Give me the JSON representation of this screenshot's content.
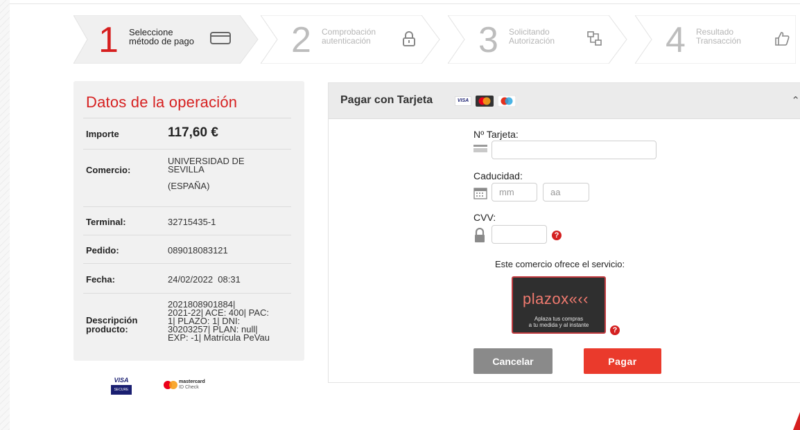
{
  "steps": [
    {
      "number": "1",
      "line1": "Seleccione",
      "line2": "método de pago",
      "icon": "credit-card-icon",
      "active": true
    },
    {
      "number": "2",
      "line1": "Comprobación",
      "line2": "autenticación",
      "icon": "lock-icon",
      "active": false
    },
    {
      "number": "3",
      "line1": "Solicitando",
      "line2": "Autorización",
      "icon": "network-icon",
      "active": false
    },
    {
      "number": "4",
      "line1": "Resultado",
      "line2": "Transacción",
      "icon": "thumbs-up-icon",
      "active": false
    }
  ],
  "operation": {
    "title": "Datos de la operación",
    "importe_label": "Importe",
    "importe_value": "117,60 €",
    "comercio_label": "Comercio:",
    "comercio_value_1": "UNIVERSIDAD DE",
    "comercio_value_2": "SEVILLA",
    "comercio_value_3": "(ESPAÑA)",
    "terminal_label": "Terminal:",
    "terminal_value": "32715435-1",
    "pedido_label": "Pedido:",
    "pedido_value": "089018083121",
    "fecha_label": "Fecha:",
    "fecha_value": "24/02/2022  08:31",
    "descripcion_label_1": "Descripción",
    "descripcion_label_2": "producto:",
    "descripcion_lines": [
      "2021808901884|",
      "2021-22| ACE: 400| PAC:",
      "1| PLAZO: 1| DNI:",
      "30203257| PLAN: null|",
      "EXP: -1| Matrícula PeVau"
    ]
  },
  "footer_badges": {
    "visa": "VISA",
    "visa_sub": "SECURE",
    "mastercard": "mastercard",
    "mastercard_sub": "ID Check"
  },
  "payment": {
    "header_title": "Pagar con Tarjeta",
    "visa_mini": "VISA",
    "card_label": "Nº Tarjeta:",
    "card_value": "",
    "expiry_label": "Caducidad:",
    "month_placeholder": "mm",
    "year_placeholder": "aa",
    "cvv_label": "CVV:",
    "cvv_value": "",
    "service_text": "Este comercio ofrece el servicio:",
    "plazox_logo": "plazox«‹‹",
    "plazox_tagline_1": "Aplaza tus compras",
    "plazox_tagline_2": "a tu medida y al instante",
    "help_mark": "?",
    "cancel_label": "Cancelar",
    "pay_label": "Pagar"
  },
  "colors": {
    "accent_red": "#d61f1f",
    "pay_button": "#ea3a2c",
    "cancel_button": "#8a8a8a"
  }
}
